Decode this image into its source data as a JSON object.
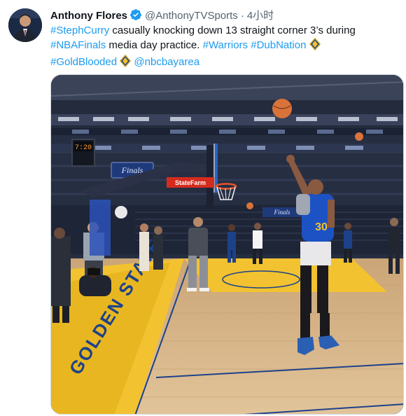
{
  "author": {
    "name": "Anthony Flores",
    "handle": "@AnthonyTVSports",
    "separator": "·",
    "time": "4小时",
    "verified": true
  },
  "tweet": {
    "t1": "#StephCurry",
    "t2": " casually knocking down 13 straight corner 3’s during ",
    "t3": "#NBAFinals",
    "t4": " media day practice. ",
    "t5": "#Warriors",
    "t6": " ",
    "t7": "#DubNation",
    "t8": " ",
    "t9": "#GoldBlooded",
    "t10": " ",
    "t11": "@nbcbayarea"
  },
  "media": {
    "shot_clock": "7:20",
    "sponsor_banner": "StateFarm",
    "finals_board": "Finals",
    "finals_board_right": "Finals",
    "floor_text": "GOLDEN STATE",
    "jersey_number": "30"
  },
  "colors": {
    "link": "#1d9bf0",
    "handle": "#536471",
    "verified": "#1d9bf0",
    "court_wood": "#d9b98c",
    "paint_gold": "#f2c230",
    "warriors_blue": "#1d428a"
  },
  "icons": [
    "avatar",
    "verified-badge-icon",
    "diamond-emoji-icon"
  ]
}
